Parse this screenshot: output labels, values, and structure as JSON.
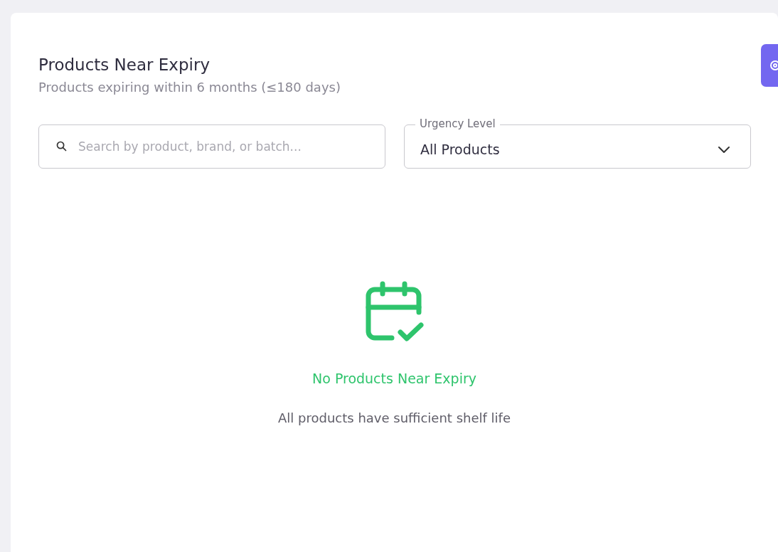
{
  "panel": {
    "title": "Products Near Expiry",
    "subtitle": "Products expiring within 6 months (≤180 days)"
  },
  "search": {
    "placeholder": "Search by product, brand, or batch..."
  },
  "urgency_select": {
    "label": "Urgency Level",
    "value": "All Products"
  },
  "empty_state": {
    "title": "No Products Near Expiry",
    "message": "All products have sufficient shelf life"
  }
}
